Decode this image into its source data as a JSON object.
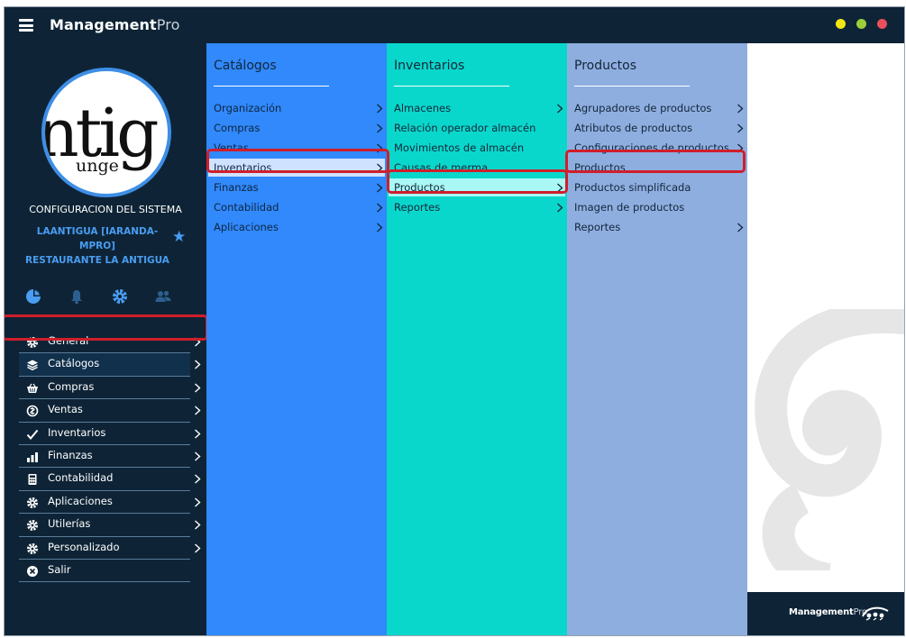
{
  "app": {
    "brand_bold": "Management",
    "brand_light": "Pro"
  },
  "sidebar": {
    "logo_text": "ntig",
    "logo_subtext": "unge",
    "system_title": "CONFIGURACION DEL SISTEMA",
    "company_line1": "LAANTIGUA [IARANDA-MPRO]",
    "company_line2": "RESTAURANTE LA ANTIGUA",
    "nav": [
      {
        "label": "General",
        "icon": "gear-icon"
      },
      {
        "label": "Catálogos",
        "icon": "layers-icon"
      },
      {
        "label": "Compras",
        "icon": "basket-icon"
      },
      {
        "label": "Ventas",
        "icon": "sales-icon"
      },
      {
        "label": "Inventarios",
        "icon": "check-icon"
      },
      {
        "label": "Finanzas",
        "icon": "bar-chart-icon"
      },
      {
        "label": "Contabilidad",
        "icon": "calculator-icon"
      },
      {
        "label": "Aplicaciones",
        "icon": "gear-icon"
      },
      {
        "label": "Utilerías",
        "icon": "gear-icon"
      },
      {
        "label": "Personalizado",
        "icon": "gear-icon"
      },
      {
        "label": "Salir",
        "icon": "close-circle-icon"
      }
    ]
  },
  "col1": {
    "title": "Catálogos",
    "items": [
      "Organización",
      "Compras",
      "Ventas",
      "Inventarios",
      "Finanzas",
      "Contabilidad",
      "Aplicaciones"
    ]
  },
  "col2": {
    "title": "Inventarios",
    "items": [
      "Almacenes",
      "Relación operador almacén",
      "Movimientos de almacén",
      "Causas de merma",
      "Productos",
      "Reportes"
    ]
  },
  "col3": {
    "title": "Productos",
    "items": [
      "Agrupadores de productos",
      "Atributos de productos",
      "Configuraciones de productos",
      "Productos",
      "Productos simplificada",
      "Imagen de productos",
      "Reportes"
    ]
  },
  "footer": {
    "brand_bold": "Management",
    "brand_light": "Pro"
  },
  "colors": {
    "sidebar_bg": "#0e2436",
    "col1_bg": "#3189fb",
    "col2_bg": "#0ad7cb",
    "col3_bg": "#8faee0",
    "highlight": "#d01e2b",
    "accent": "#4a9df2"
  }
}
